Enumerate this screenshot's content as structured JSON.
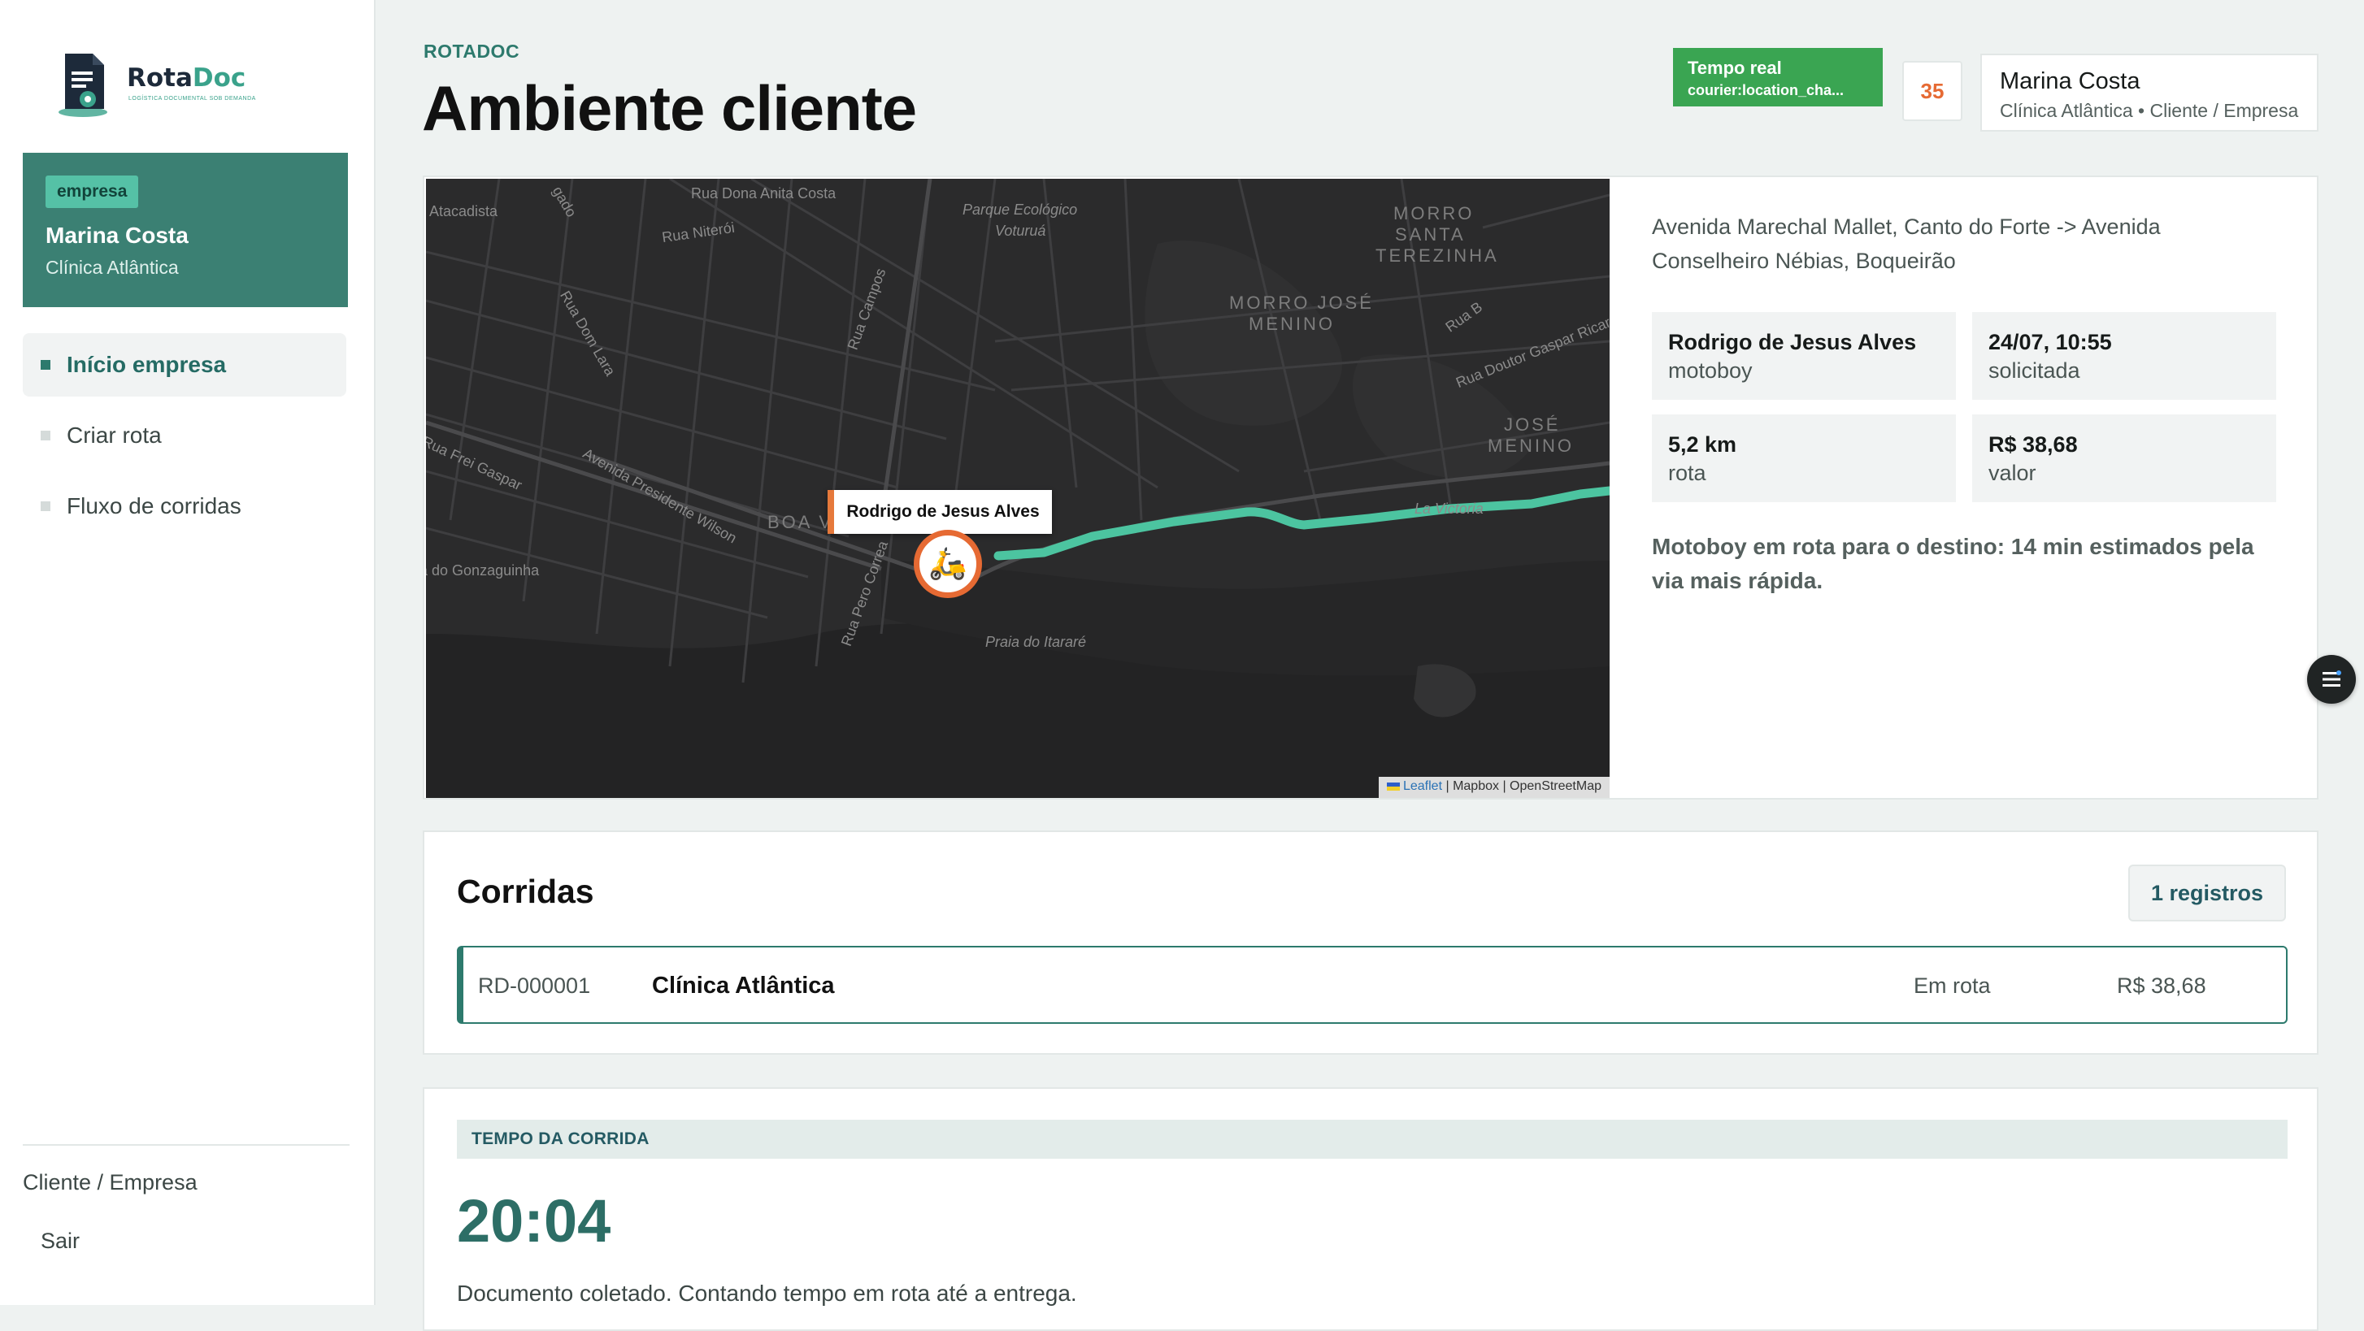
{
  "brand": {
    "name_part1": "Rota",
    "name_part2": "Doc",
    "tagline": "LOGÍSTICA DOCUMENTAL SOB DEMANDA"
  },
  "sidebar": {
    "company_badge": "empresa",
    "user_name": "Marina Costa",
    "company_name": "Clínica Atlântica",
    "nav": [
      {
        "label": "Início empresa",
        "active": true
      },
      {
        "label": "Criar rota",
        "active": false
      },
      {
        "label": "Fluxo de corridas",
        "active": false
      }
    ],
    "role_label": "Cliente / Empresa",
    "logout_label": "Sair"
  },
  "header": {
    "eyebrow": "ROTADOC",
    "title": "Ambiente cliente",
    "realtime_label": "Tempo real",
    "realtime_channel": "courier:location_cha...",
    "counter": "35",
    "user_name": "Marina Costa",
    "user_meta": "Clínica Atlântica • Cliente / Empresa"
  },
  "map": {
    "courier_popup": "Rodrigo de Jesus Alves",
    "courier_icon": "scooter-icon",
    "route_color": "#4cc4a0",
    "labels": [
      "Rua Dona Anita Costa",
      "Rua Niterói",
      "Parque Ecológico",
      "Voturuá",
      "MORRO",
      "SANTA",
      "TEREZINHA",
      "MORRO JOSÉ",
      "MENINO",
      "JOSÉ",
      "MENINO",
      "Rua B",
      "Rua Doutor Gaspar Ricardo",
      "Rua Campos",
      "Rua Dom Lara",
      "Avenida Presidente Wilson",
      "BOA V",
      "Rua Frei Gaspar",
      "Praia do Gonzaguinha",
      "Rua Pero Correa",
      "Praia do Itararé",
      "La Victoria",
      "Atacadista",
      "gado"
    ],
    "attribution_leaflet": "Leaflet",
    "attribution_rest": " | Mapbox | OpenStreetMap"
  },
  "route": {
    "description": "Avenida Marechal Mallet, Canto do Forte -> Avenida Conselheiro Nébias, Boqueirão",
    "stats": [
      {
        "value": "Rodrigo de Jesus Alves",
        "label": "motoboy"
      },
      {
        "value": "24/07, 10:55",
        "label": "solicitada"
      },
      {
        "value": "5,2 km",
        "label": "rota"
      },
      {
        "value": "R$ 38,68",
        "label": "valor"
      }
    ],
    "eta_text": "Motoboy em rota para o destino: 14 min estimados pela via mais rápida."
  },
  "rides": {
    "title": "Corridas",
    "count_label": "1 registros",
    "rows": [
      {
        "id": "RD-000001",
        "client": "Clínica Atlântica",
        "status": "Em rota",
        "value": "R$ 38,68"
      }
    ]
  },
  "timer": {
    "header": "TEMPO DA CORRIDA",
    "value": "20:04",
    "note": "Documento coletado. Contando tempo em rota até a entrega."
  },
  "colors": {
    "primary": "#2d7a6d",
    "sidebar_card": "#3b8073",
    "realtime": "#3aa552",
    "accent_orange": "#e66a33"
  }
}
